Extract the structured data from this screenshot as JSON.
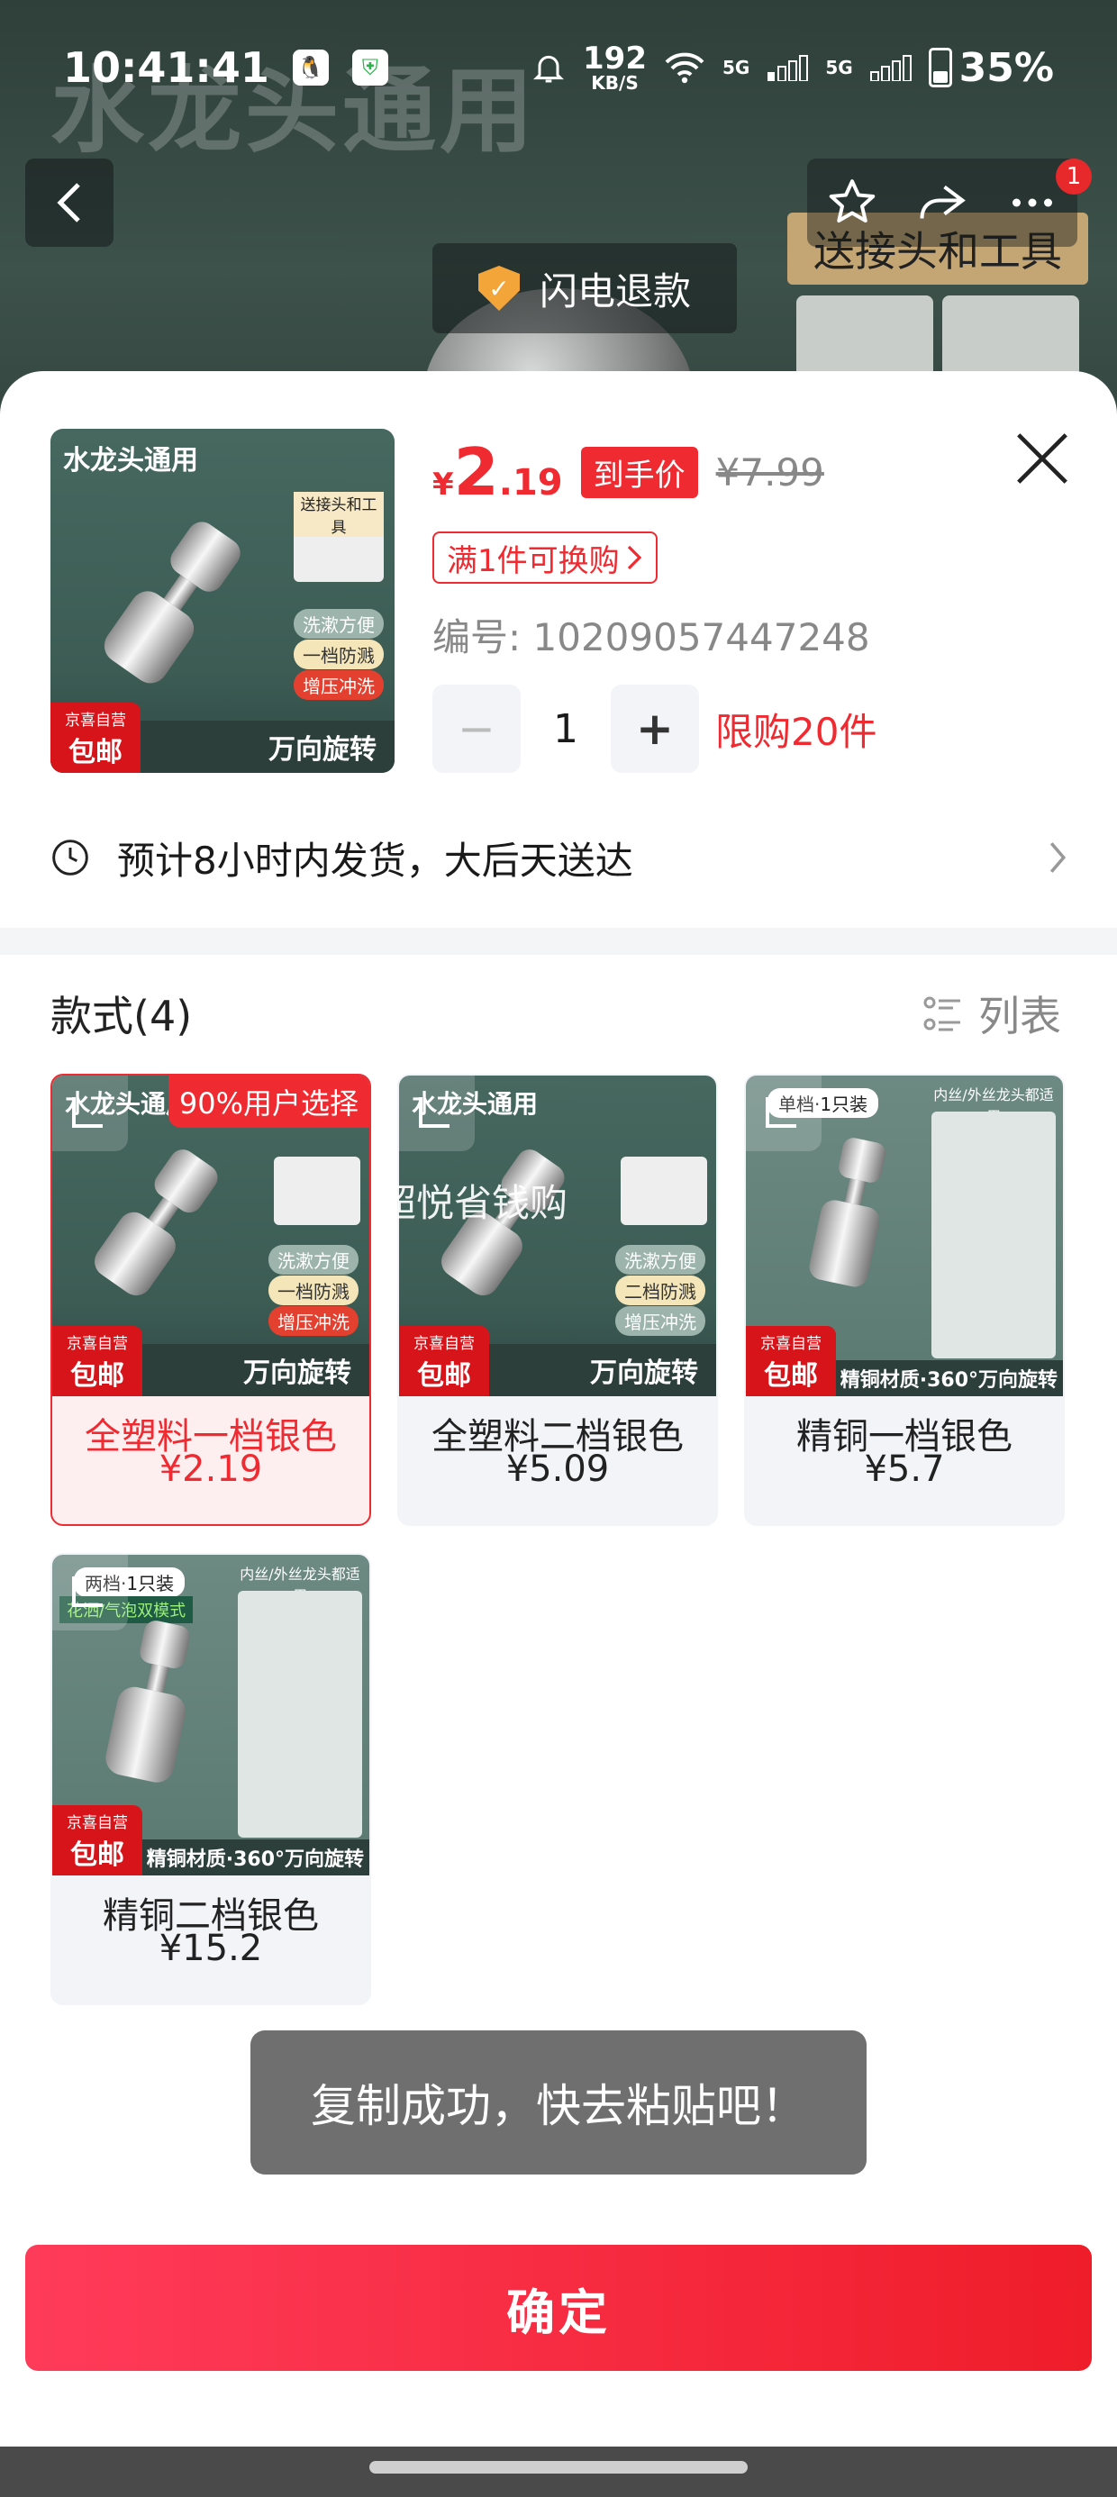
{
  "status_bar": {
    "time": "10:41:41",
    "net_speed": "192",
    "net_unit": "KB/S",
    "battery": "35%",
    "signal_1": "5G",
    "signal_2": "5G"
  },
  "background": {
    "title": "水龙头通用",
    "flash_refund": "闪电退款",
    "tools_label": "送接头和工具",
    "cart_count": "1"
  },
  "product": {
    "currency": "¥",
    "price_int": "2",
    "price_dec": ".19",
    "hand_price_label": "到手价",
    "original_price": "¥7.99",
    "exchange_label": "满1件可换购",
    "sku_label": "编号: 10209057447248",
    "quantity": "1",
    "limit_label": "限购20件",
    "shipping": "预计8小时内发货，大后天送达"
  },
  "thumb_art": {
    "title": "水龙头通用",
    "tools_title": "送接头和工具",
    "pill_1": "洗漱方便",
    "pill_2": "一档防溅",
    "pill_3": "增压冲洗",
    "band": "万向旋转",
    "jx_top": "京喜自营",
    "jx_main": "包邮"
  },
  "styles_section": {
    "heading": "款式(4)",
    "list_toggle": "列表",
    "popular_tag": "90%用户选择",
    "watermark": "超悦省钱购",
    "items": [
      {
        "name": "全塑料一档银色",
        "price": "¥2.19",
        "art_title": "水龙头通用",
        "pill_1": "洗漱方便",
        "pill_2": "一档防溅",
        "pill_3": "增压冲洗",
        "band": "万向旋转"
      },
      {
        "name": "全塑料二档银色",
        "price": "¥5.09",
        "art_title": "水龙头通用",
        "pill_1": "洗漱方便",
        "pill_2": "二档防溅",
        "pill_3": "增压冲洗",
        "band": "万向旋转"
      },
      {
        "name": "精铜一档银色",
        "price": "¥5.7",
        "art_tag": "单档·1只装",
        "side_head": "内丝/外丝龙头都适用",
        "band": "精铜材质·360°万向旋转"
      },
      {
        "name": "精铜二档银色",
        "price": "¥15.2",
        "art_tag": "两档·1只装",
        "mode_tag": "花洒/气泡双模式",
        "side_head": "内丝/外丝龙头都适用",
        "band": "精铜材质·360°万向旋转"
      }
    ]
  },
  "toast": "复制成功，快去粘贴吧！",
  "confirm_button": "确定",
  "colors": {
    "accent": "#ef2a31",
    "toast_bg": "#6f6f6f"
  }
}
